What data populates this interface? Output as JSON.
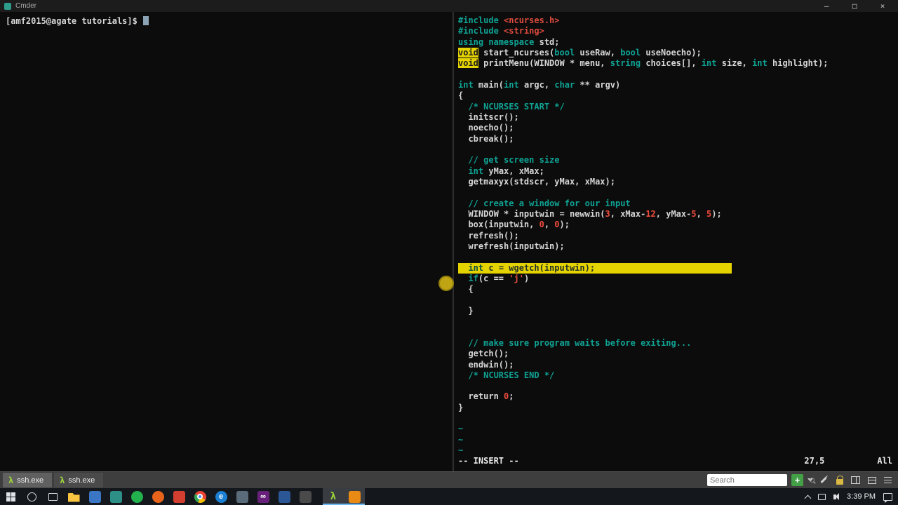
{
  "colors": {
    "kw": "#0fa394",
    "cm": "#0fa394",
    "num": "#ee4b3e",
    "str": "#dd4b3e",
    "id": "#d6d6d6",
    "hl": "#e5d300",
    "accentgreen": "#43a047",
    "lambdagreen": "#9ed63c",
    "taskbar": "#14171c"
  },
  "window": {
    "title": "Cmder",
    "controls": [
      {
        "name": "minimize",
        "glyph": "–"
      },
      {
        "name": "maximize",
        "glyph": "□"
      },
      {
        "name": "close",
        "glyph": "×"
      }
    ]
  },
  "terminal": {
    "prompt": "[amf2015@agate tutorials]$"
  },
  "editor": {
    "lines": [
      {
        "tokens": [
          {
            "t": "#include ",
            "c": "kw"
          },
          {
            "t": "<ncurses.h>",
            "c": "str"
          }
        ]
      },
      {
        "tokens": [
          {
            "t": "#include ",
            "c": "kw"
          },
          {
            "t": "<string>",
            "c": "str"
          }
        ]
      },
      {
        "tokens": [
          {
            "t": "using namespace ",
            "c": "kw"
          },
          {
            "t": "std;",
            "c": "id"
          }
        ]
      },
      {
        "tokens": [
          {
            "t": "void",
            "c": "hlkw"
          },
          {
            "t": " start_ncurses(",
            "c": "id"
          },
          {
            "t": "bool",
            "c": "kw"
          },
          {
            "t": " useRaw, ",
            "c": "id"
          },
          {
            "t": "bool",
            "c": "kw"
          },
          {
            "t": " useNoecho);",
            "c": "id"
          }
        ]
      },
      {
        "tokens": [
          {
            "t": "void",
            "c": "hlkw"
          },
          {
            "t": " printMenu(WINDOW * menu, ",
            "c": "id"
          },
          {
            "t": "string",
            "c": "kw"
          },
          {
            "t": " choices[], ",
            "c": "id"
          },
          {
            "t": "int",
            "c": "kw"
          },
          {
            "t": " size, ",
            "c": "id"
          },
          {
            "t": "int",
            "c": "kw"
          },
          {
            "t": " highlight);",
            "c": "id"
          }
        ]
      },
      {
        "tokens": []
      },
      {
        "tokens": [
          {
            "t": "int",
            "c": "kw"
          },
          {
            "t": " main(",
            "c": "id"
          },
          {
            "t": "int",
            "c": "kw"
          },
          {
            "t": " argc, ",
            "c": "id"
          },
          {
            "t": "char",
            "c": "kw"
          },
          {
            "t": " ** argv)",
            "c": "id"
          }
        ]
      },
      {
        "tokens": [
          {
            "t": "{",
            "c": "id"
          }
        ]
      },
      {
        "tokens": [
          {
            "t": "  ",
            "c": "id"
          },
          {
            "t": "/* NCURSES START */",
            "c": "cm"
          }
        ]
      },
      {
        "tokens": [
          {
            "t": "  initscr();",
            "c": "id"
          }
        ]
      },
      {
        "tokens": [
          {
            "t": "  noecho();",
            "c": "id"
          }
        ]
      },
      {
        "tokens": [
          {
            "t": "  cbreak();",
            "c": "id"
          }
        ]
      },
      {
        "tokens": []
      },
      {
        "tokens": [
          {
            "t": "  ",
            "c": "id"
          },
          {
            "t": "// get screen size",
            "c": "cm"
          }
        ]
      },
      {
        "tokens": [
          {
            "t": "  ",
            "c": "id"
          },
          {
            "t": "int",
            "c": "kw"
          },
          {
            "t": " yMax, xMax;",
            "c": "id"
          }
        ]
      },
      {
        "tokens": [
          {
            "t": "  getmaxyx(stdscr, yMax, xMax);",
            "c": "id"
          }
        ]
      },
      {
        "tokens": []
      },
      {
        "tokens": [
          {
            "t": "  ",
            "c": "id"
          },
          {
            "t": "// create a window for our input",
            "c": "cm"
          }
        ]
      },
      {
        "tokens": [
          {
            "t": "  WINDOW * inputwin = newwin(",
            "c": "id"
          },
          {
            "t": "3",
            "c": "num"
          },
          {
            "t": ", xMax-",
            "c": "id"
          },
          {
            "t": "12",
            "c": "num"
          },
          {
            "t": ", yMax-",
            "c": "id"
          },
          {
            "t": "5",
            "c": "num"
          },
          {
            "t": ", ",
            "c": "id"
          },
          {
            "t": "5",
            "c": "num"
          },
          {
            "t": ");",
            "c": "id"
          }
        ]
      },
      {
        "tokens": [
          {
            "t": "  box(inputwin, ",
            "c": "id"
          },
          {
            "t": "0",
            "c": "num"
          },
          {
            "t": ", ",
            "c": "id"
          },
          {
            "t": "0",
            "c": "num"
          },
          {
            "t": ");",
            "c": "id"
          }
        ]
      },
      {
        "tokens": [
          {
            "t": "  refresh();",
            "c": "id"
          }
        ]
      },
      {
        "tokens": [
          {
            "t": "  wrefresh(inputwin);",
            "c": "id"
          }
        ]
      },
      {
        "tokens": []
      },
      {
        "hl": true,
        "tokens": [
          {
            "t": "  ",
            "c": "id"
          },
          {
            "t": "int",
            "c": "kw"
          },
          {
            "t": " c = wgetch(inputwin);",
            "c": "id"
          }
        ]
      },
      {
        "tokens": [
          {
            "t": "  ",
            "c": "id"
          },
          {
            "t": "if",
            "c": "kw"
          },
          {
            "t": "(c == ",
            "c": "id"
          },
          {
            "t": "'j'",
            "c": "str"
          },
          {
            "t": ")",
            "c": "id"
          }
        ]
      },
      {
        "tokens": [
          {
            "t": "  {",
            "c": "id"
          }
        ]
      },
      {
        "tokens": []
      },
      {
        "tokens": [
          {
            "t": "  }",
            "c": "id"
          }
        ]
      },
      {
        "tokens": []
      },
      {
        "tokens": []
      },
      {
        "tokens": [
          {
            "t": "  ",
            "c": "id"
          },
          {
            "t": "// make sure program waits before exiting...",
            "c": "cm"
          }
        ]
      },
      {
        "tokens": [
          {
            "t": "  getch();",
            "c": "id"
          }
        ]
      },
      {
        "tokens": [
          {
            "t": "  endwin();",
            "c": "id"
          }
        ]
      },
      {
        "tokens": [
          {
            "t": "  ",
            "c": "id"
          },
          {
            "t": "/* NCURSES END */",
            "c": "cm"
          }
        ]
      },
      {
        "tokens": []
      },
      {
        "tokens": [
          {
            "t": "  return ",
            "c": "id"
          },
          {
            "t": "0",
            "c": "num"
          },
          {
            "t": ";",
            "c": "id"
          }
        ]
      },
      {
        "tokens": [
          {
            "t": "}",
            "c": "id"
          }
        ]
      },
      {
        "tokens": []
      },
      {
        "tokens": [
          {
            "t": "~",
            "c": "kw"
          }
        ]
      },
      {
        "tokens": [
          {
            "t": "~",
            "c": "kw"
          }
        ]
      },
      {
        "tokens": [
          {
            "t": "~",
            "c": "kw"
          }
        ]
      }
    ],
    "status": {
      "mode": "-- INSERT --",
      "position": "27,5",
      "scroll": "All"
    }
  },
  "tabbar": {
    "tabs": [
      {
        "label": "ssh.exe",
        "glyph": "λ",
        "active": true
      },
      {
        "label": "ssh.exe",
        "glyph": "λ",
        "active": false
      }
    ],
    "search_placeholder": "Search",
    "new_tab_glyph": "+"
  },
  "taskbar": {
    "apps": [
      {
        "name": "file-explorer",
        "shape": "folder",
        "bg": "#f9c440",
        "glyph": ""
      },
      {
        "name": "app-blue",
        "shape": "square",
        "bg": "#3a76c4",
        "glyph": ""
      },
      {
        "name": "app-teal",
        "shape": "square",
        "bg": "#2e8f86",
        "glyph": ""
      },
      {
        "name": "app-green-circle",
        "shape": "circle",
        "bg": "#23b14d",
        "glyph": ""
      },
      {
        "name": "firefox",
        "shape": "circle",
        "bg": "#e8641b",
        "glyph": ""
      },
      {
        "name": "app-red",
        "shape": "square",
        "bg": "#d23f31",
        "glyph": ""
      },
      {
        "name": "chrome",
        "shape": "chrome",
        "bg": "",
        "glyph": ""
      },
      {
        "name": "edge",
        "shape": "circle",
        "bg": "#1b7fd4",
        "glyph": "e"
      },
      {
        "name": "app-slate",
        "shape": "square",
        "bg": "#5a6b7a",
        "glyph": ""
      },
      {
        "name": "visual-studio",
        "shape": "square",
        "bg": "#68217a",
        "glyph": "∞"
      },
      {
        "name": "app-blue-2",
        "shape": "square",
        "bg": "#2b5797",
        "glyph": ""
      },
      {
        "name": "app-dark",
        "shape": "square",
        "bg": "#4a4a4a",
        "glyph": ""
      },
      {
        "name": "cmder",
        "shape": "lambda",
        "bg": "",
        "glyph": "λ",
        "active": true,
        "gap": true
      },
      {
        "name": "sublime-text",
        "shape": "square",
        "bg": "#e98a15",
        "glyph": "",
        "active": true
      }
    ],
    "time": "3:39 PM"
  }
}
